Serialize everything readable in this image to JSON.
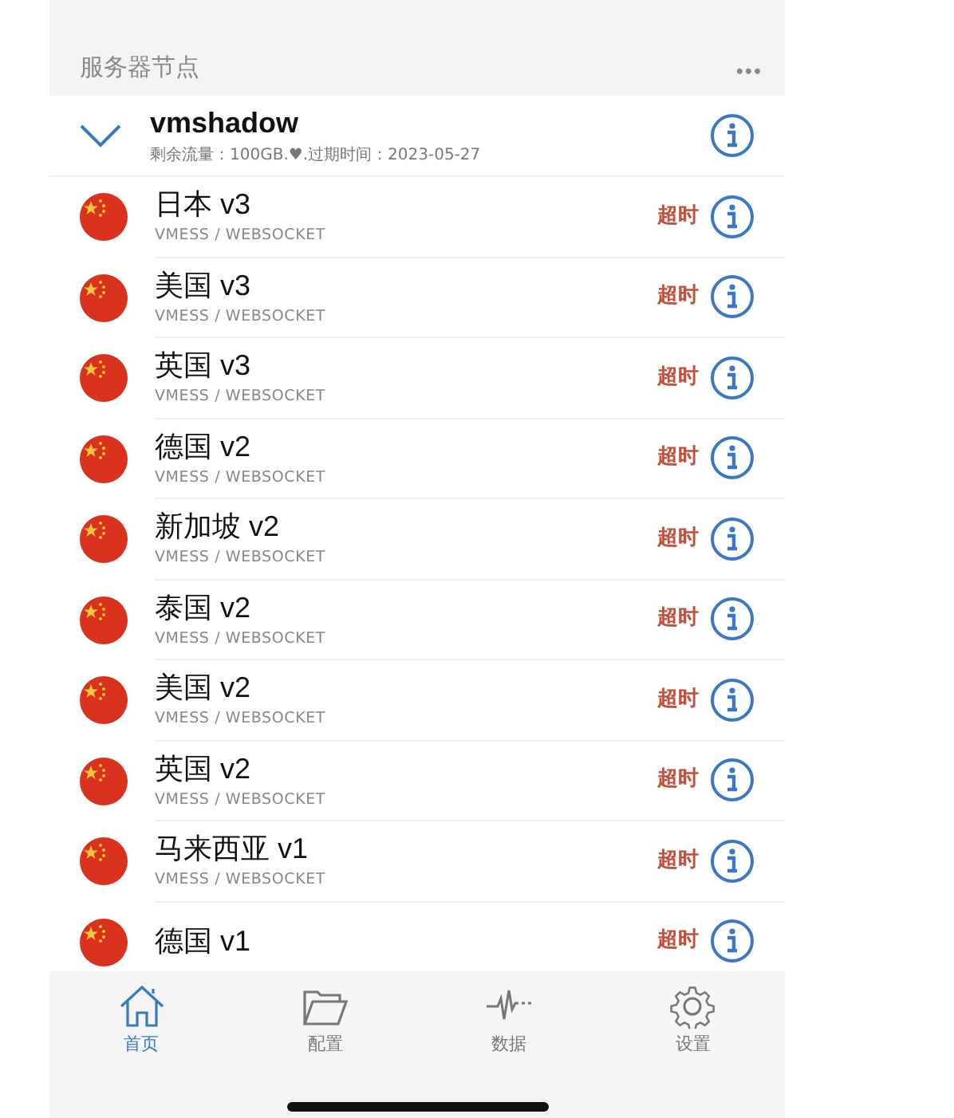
{
  "header": {
    "title": "服务器节点",
    "menu": "•••"
  },
  "group": {
    "name": "vmshadow",
    "info": "剩余流量：100GB.♥.过期时间：2023-05-27",
    "expanded": true
  },
  "servers": [
    {
      "name": "日本 v3",
      "protocol": "VMESS / WEBSOCKET",
      "status": "超时"
    },
    {
      "name": "美国 v3",
      "protocol": "VMESS / WEBSOCKET",
      "status": "超时"
    },
    {
      "name": "英国 v3",
      "protocol": "VMESS / WEBSOCKET",
      "status": "超时"
    },
    {
      "name": "德国 v2",
      "protocol": "VMESS / WEBSOCKET",
      "status": "超时"
    },
    {
      "name": "新加坡 v2",
      "protocol": "VMESS / WEBSOCKET",
      "status": "超时"
    },
    {
      "name": "泰国 v2",
      "protocol": "VMESS / WEBSOCKET",
      "status": "超时"
    },
    {
      "name": "美国 v2",
      "protocol": "VMESS / WEBSOCKET",
      "status": "超时"
    },
    {
      "name": "英国 v2",
      "protocol": "VMESS / WEBSOCKET",
      "status": "超时"
    },
    {
      "name": "马来西亚 v1",
      "protocol": "VMESS / WEBSOCKET",
      "status": "超时"
    },
    {
      "name": "德国 v1",
      "status": "超时"
    }
  ],
  "tabs": [
    {
      "label": "首页",
      "selected": true
    },
    {
      "label": "配置",
      "selected": false
    },
    {
      "label": "数据",
      "selected": false
    },
    {
      "label": "设置",
      "selected": false
    }
  ]
}
